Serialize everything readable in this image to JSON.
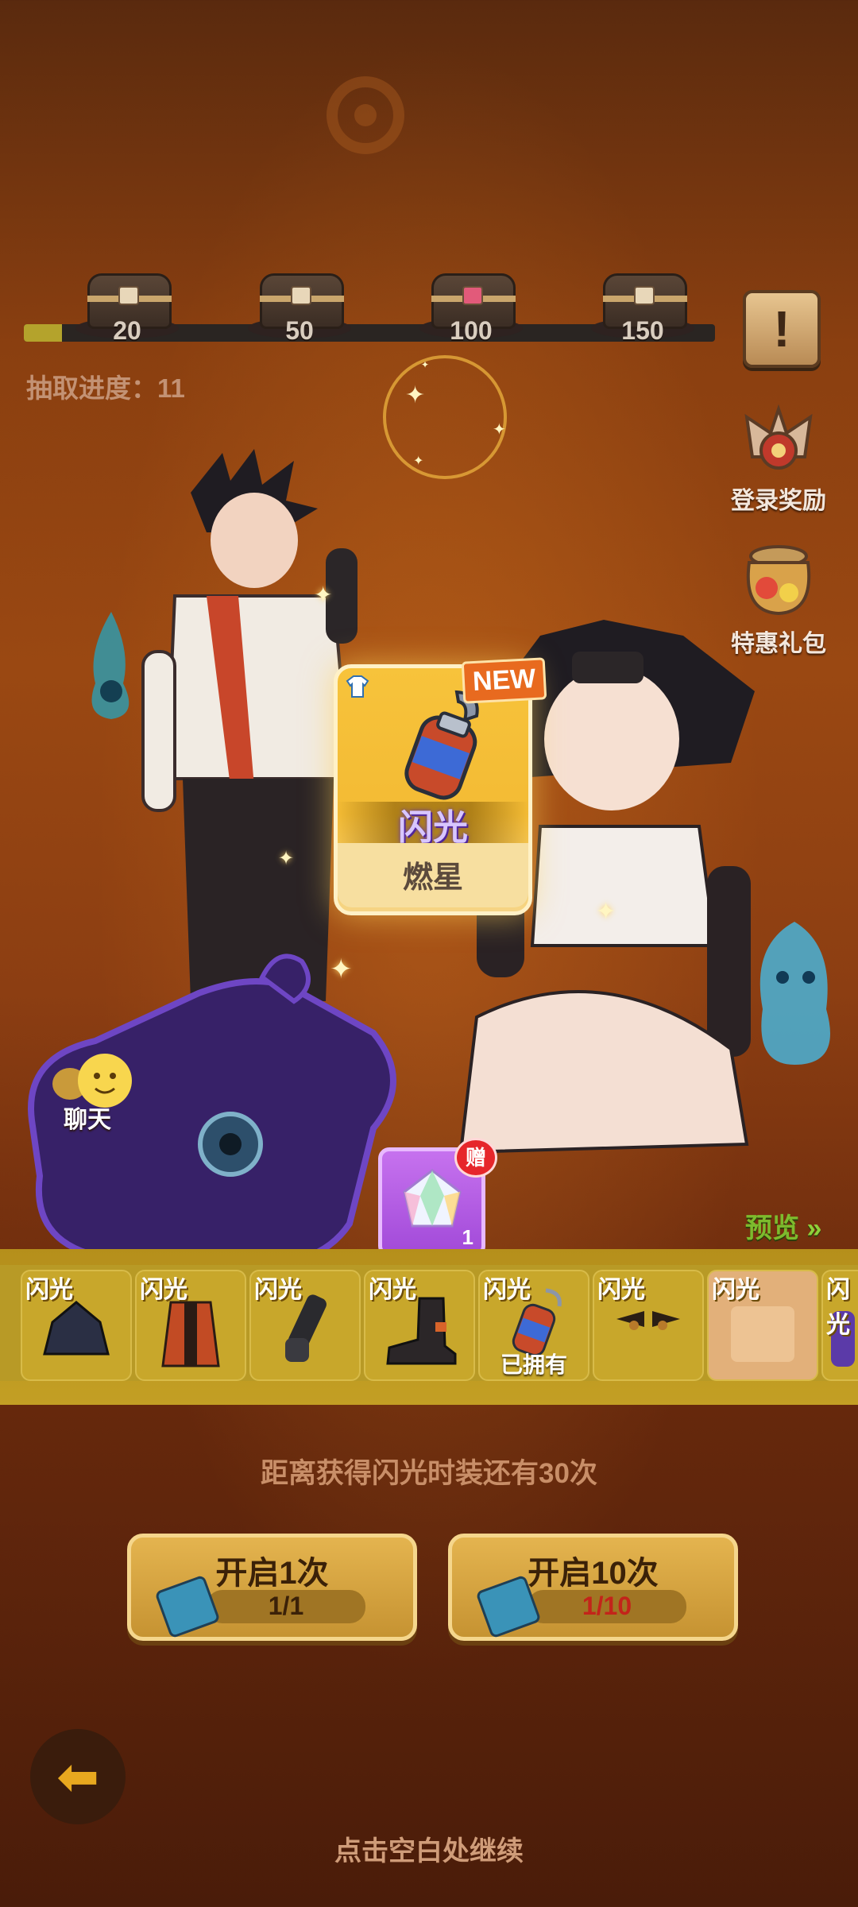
{
  "progress": {
    "milestones": [
      "20",
      "50",
      "100",
      "150"
    ],
    "fill_fraction": 0.055,
    "label": "抽取进度：11"
  },
  "side": {
    "login_reward": "登录奖励",
    "special_gift": "特惠礼包"
  },
  "card": {
    "badge": "NEW",
    "rarity": "闪光",
    "name": "燃星"
  },
  "gift": {
    "tag": "赠",
    "count": "1"
  },
  "chat": {
    "label": "聊天"
  },
  "preview": {
    "link": "预览",
    "slots": [
      {
        "label": "闪光",
        "owned": ""
      },
      {
        "label": "闪光",
        "owned": ""
      },
      {
        "label": "闪光",
        "owned": ""
      },
      {
        "label": "闪光",
        "owned": ""
      },
      {
        "label": "闪光",
        "owned": "已拥有"
      },
      {
        "label": "闪光",
        "owned": ""
      },
      {
        "label": "闪光",
        "owned": ""
      },
      {
        "label": "闪光",
        "owned": ""
      }
    ]
  },
  "footer": {
    "remaining": "距离获得闪光时装还有30次",
    "open1": {
      "title": "开启1次",
      "cost": "1/1",
      "cost_color": "#3b2108"
    },
    "open10": {
      "title": "开启10次",
      "cost": "1/10",
      "cost_color": "#c3241a"
    },
    "continue": "点击空白处继续"
  },
  "colors": {
    "accent_gold": "#f3bb34",
    "rarity_purple": "#d8c6ff",
    "new_badge": "#e86a1f"
  }
}
